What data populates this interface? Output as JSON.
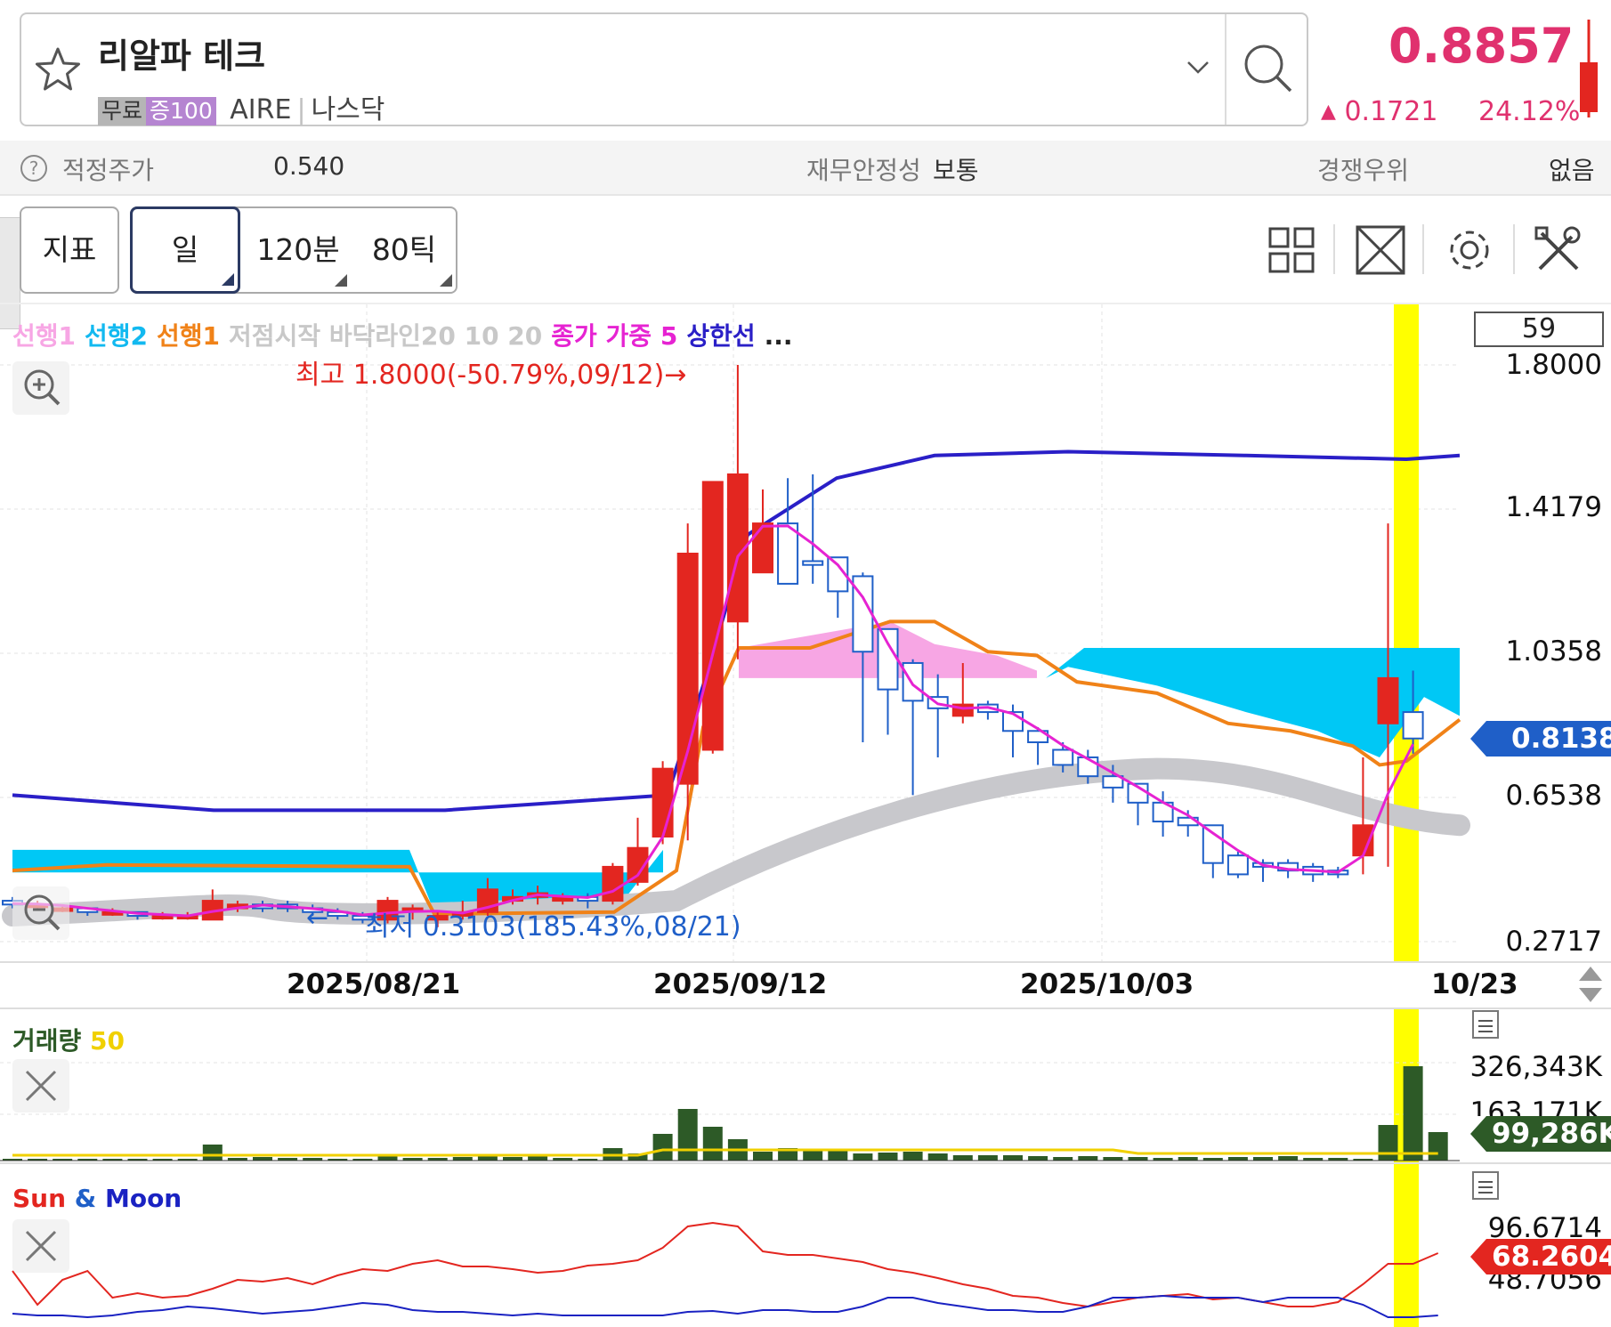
{
  "stock": {
    "name": "리알파 테크",
    "tag_free": "무료",
    "tag_margin": "증100",
    "ticker": "AIRE",
    "market": "나스닥",
    "price": "0.8857",
    "change_arrow": "▲",
    "change": "0.1721",
    "change_pct": "24.12%"
  },
  "info_bar": {
    "fair_price_label": "적정주가",
    "fair_price": "0.540",
    "stability_label": "재무안정성",
    "stability": "보통",
    "competitive_label": "경쟁우위",
    "competitive": "없음"
  },
  "toolbar": {
    "indicator_label": "지표",
    "period_day": "일",
    "period_120m": "120분",
    "period_80tick": "80틱"
  },
  "legend": [
    {
      "text": "선행1",
      "color": "#f7a6e4"
    },
    {
      "text": "선행2",
      "color": "#12b9f0"
    },
    {
      "text": "선행1",
      "color": "#f08218"
    },
    {
      "text": "저점시작 바닥라인20 10 20",
      "color": "#c8c8c8"
    },
    {
      "text": "종가 가중 5",
      "color": "#e623d2"
    },
    {
      "text": "상한선",
      "color": "#2a1fc7"
    },
    {
      "text": "...",
      "color": "#222222"
    }
  ],
  "main_chart": {
    "visible_bars": "59",
    "current_price_tag": "0.8138",
    "high_annotation": "최고 1.8000(-50.79%,09/12)",
    "low_annotation": "최저 0.3103(185.43%,08/21)",
    "y_ticks": [
      "1.8000",
      "1.4179",
      "1.0358",
      "0.6538",
      "0.2717"
    ],
    "x_ticks": [
      "2025/08/21",
      "2025/09/12",
      "2025/10/03",
      "10/23"
    ]
  },
  "volume": {
    "title": "거래량",
    "period": "50",
    "title_color": "#2d5a27",
    "period_color": "#f0d000",
    "y_ticks": [
      "326,343K",
      "163,171K"
    ],
    "current_tag": "99,286K"
  },
  "sunmoon": {
    "title_sun": "Sun",
    "title_amp": "&",
    "title_moon": "Moon",
    "y_ticks": [
      "96.6714",
      "48.7056"
    ],
    "current_tag": "68.2604"
  },
  "chart_data": {
    "type": "candlestick",
    "ylim": [
      0.2717,
      1.8
    ],
    "x_range": [
      "2025/07/31",
      "2025/10/23"
    ],
    "high": {
      "value": 1.8,
      "date": "09/12"
    },
    "low": {
      "value": 0.3103,
      "date": "08/21"
    },
    "last_close": 0.8138,
    "volume_last": "99,286K",
    "sunmoon_last": 68.2604
  },
  "colors": {
    "up": "#e32620",
    "down": "#1f5fc8",
    "upper_band": "#2a1fc7",
    "weighted_close": "#e623d2",
    "cloud_cyan": "#00c8f5",
    "cloud_pink": "#f7a6e4",
    "lead1_line": "#f08218",
    "floor_band": "#c8c8cc",
    "highlight": "#ffff00",
    "volume_bar": "#2d5a27",
    "volume_ma": "#f0d000",
    "sun": "#e32620",
    "moon": "#1a22c2"
  }
}
